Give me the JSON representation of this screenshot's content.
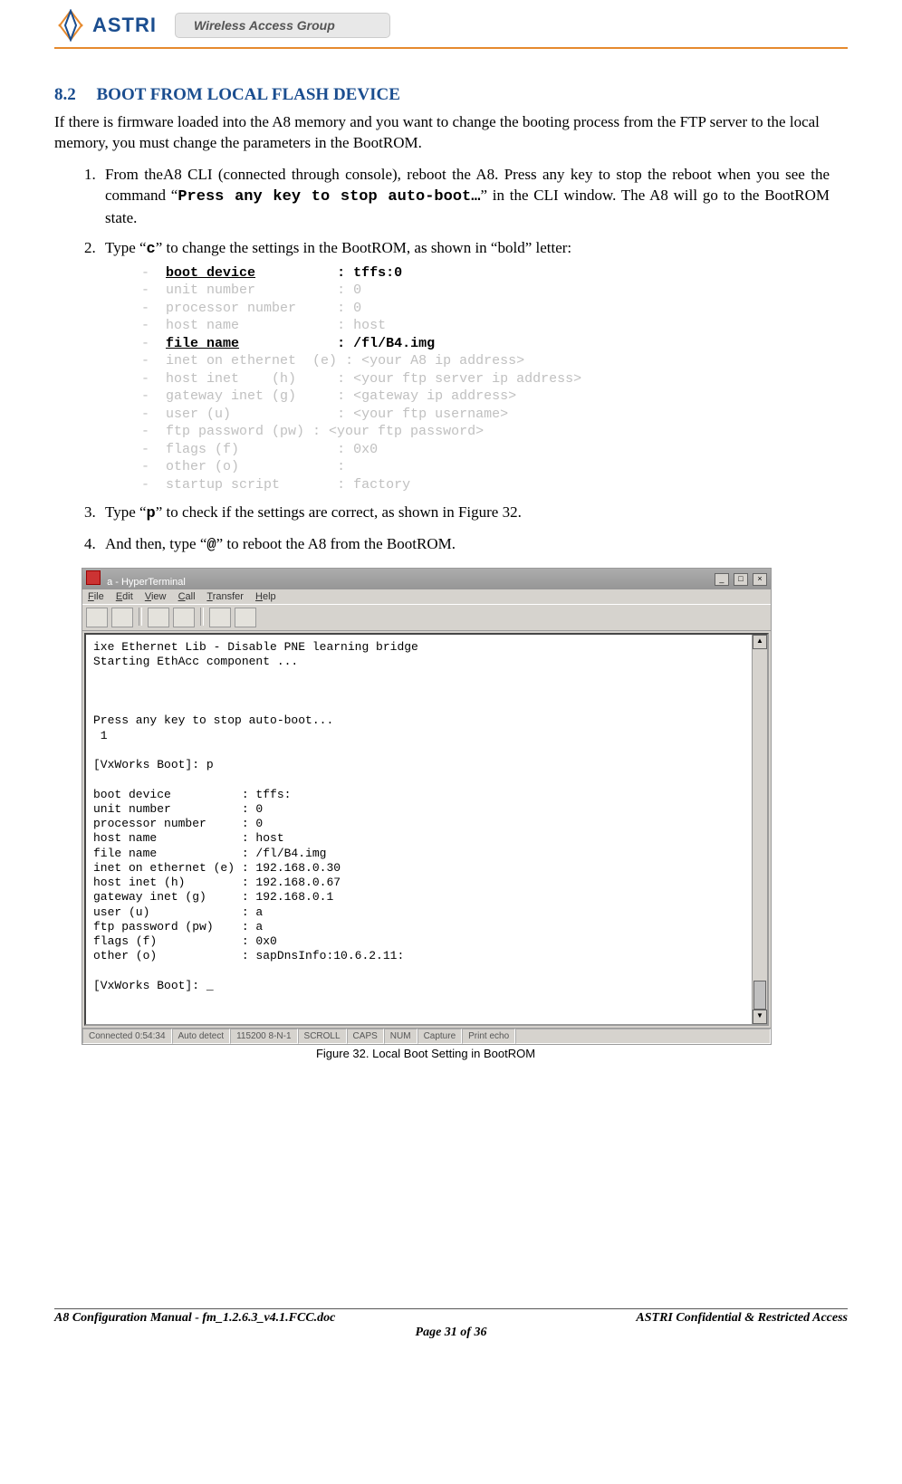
{
  "header": {
    "logo_text": "ASTRI",
    "wag_label": "Wireless Access Group"
  },
  "section": {
    "number": "8.2",
    "title": "BOOT FROM LOCAL FLASH DEVICE"
  },
  "intro": "If there is firmware loaded into the A8 memory and you want to change the booting process from the FTP server to the local memory, you must change the parameters in the BootROM.",
  "steps": {
    "s1": {
      "pre": "From theA8 CLI (connected through console), reboot the A8. Press any key to stop the reboot when you see the command “",
      "cmd": "Press any key to stop auto-boot…",
      "post": "” in the CLI window. The A8 will go to the BootROM state."
    },
    "s2": {
      "pre": "Type “",
      "key": "c",
      "post": "” to change the settings in the BootROM, as shown in “bold” letter:"
    },
    "s3": {
      "pre": "Type “",
      "key": "p",
      "post": "” to check if the settings are correct, as shown in Figure 32."
    },
    "s4": {
      "pre": "And then, type “",
      "key": "@",
      "post": "” to reboot the A8 from the BootROM."
    }
  },
  "bootrom": {
    "l1a": "boot device",
    "l1b": ": tffs:0",
    "l2a": "unit number",
    "l2b": ": 0",
    "l3a": "processor number",
    "l3b": ": 0",
    "l4a": "host name",
    "l4b": ": host",
    "l5a": "file name",
    "l5b": ": /fl/B4.img",
    "l6a": "inet on ethernet  (e)",
    "l6b": ": <your A8 ip address>",
    "l7a": "host inet    (h)",
    "l7b": ": <your ftp server ip address>",
    "l8a": "gateway inet (g)",
    "l8b": ": <gateway ip address>",
    "l9a": "user (u)",
    "l9b": ": <your ftp username>",
    "l10": "ftp password (pw) : <your ftp password>",
    "l11a": "flags (f)",
    "l11b": ": 0x0",
    "l12a": "other (o)",
    "l12b": ":",
    "l13a": "startup script",
    "l13b": ": factory"
  },
  "hyperterminal": {
    "title": "a - HyperTerminal",
    "menu": {
      "file": "File",
      "edit": "Edit",
      "view": "View",
      "call": "Call",
      "transfer": "Transfer",
      "help": "Help"
    },
    "terminal_text": "ixe Ethernet Lib - Disable PNE learning bridge\nStarting EthAcc component ...\n\n\n\nPress any key to stop auto-boot...\n 1\n\n[VxWorks Boot]: p\n\nboot device          : tffs:\nunit number          : 0\nprocessor number     : 0\nhost name            : host\nfile name            : /fl/B4.img\ninet on ethernet (e) : 192.168.0.30\nhost inet (h)        : 192.168.0.67\ngateway inet (g)     : 192.168.0.1\nuser (u)             : a\nftp password (pw)    : a\nflags (f)            : 0x0\nother (o)            : sapDnsInfo:10.6.2.11:\n\n[VxWorks Boot]: _",
    "status": {
      "conn": "Connected 0:54:34",
      "detect": "Auto detect",
      "mode": "115200 8-N-1",
      "scroll": "SCROLL",
      "caps": "CAPS",
      "num": "NUM",
      "capture": "Capture",
      "print": "Print echo"
    }
  },
  "figure_caption": "Figure 32. Local Boot Setting in BootROM",
  "footer": {
    "left": "A8 Configuration Manual - fm_1.2.6.3_v4.1.FCC.doc",
    "right": "ASTRI Confidential & Restricted Access",
    "center": "Page 31 of 36"
  }
}
